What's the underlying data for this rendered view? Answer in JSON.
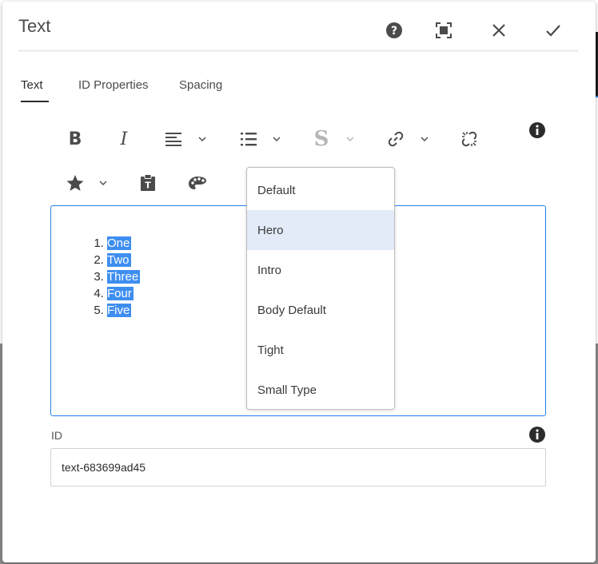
{
  "dialog": {
    "title": "Text",
    "header_buttons": [
      "help-icon",
      "fullscreen-icon",
      "close-icon",
      "check-icon"
    ]
  },
  "tabs": [
    {
      "label": "Text",
      "active": true
    },
    {
      "label": "ID Properties",
      "active": false
    },
    {
      "label": "Spacing",
      "active": false
    }
  ],
  "toolbar": {
    "row1": [
      "bold-icon",
      "italic-icon",
      "align-icon",
      "list-icon",
      "strikethrough-icon",
      "link-icon",
      "unlink-icon"
    ],
    "row2": [
      "star-icon",
      "paste-icon",
      "palette-icon"
    ],
    "bold_glyph": "B",
    "italic_glyph": "I",
    "strike_glyph": "S"
  },
  "editor": {
    "list_items": [
      "One",
      "Two",
      "Three",
      "Four",
      "Five"
    ]
  },
  "style_dropdown": {
    "options": [
      "Default",
      "Hero",
      "Intro",
      "Body Default",
      "Tight",
      "Small Type"
    ],
    "highlighted": "Hero"
  },
  "id_field": {
    "label": "ID",
    "value": "text-683699ad45"
  },
  "colors": {
    "accent": "#2680eb",
    "selection": "#3e8ef0",
    "hover": "#e2ebf7"
  }
}
